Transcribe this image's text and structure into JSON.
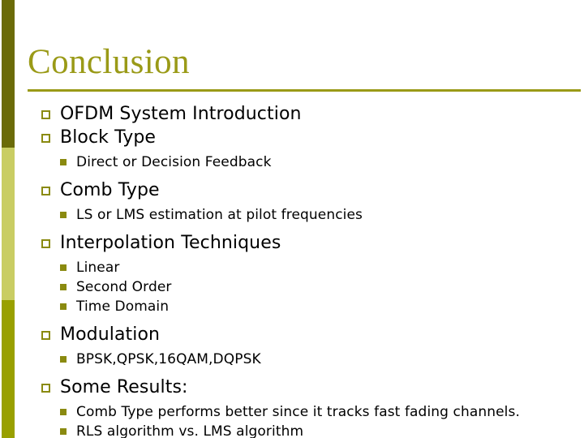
{
  "slide": {
    "title": "Conclusion",
    "colors": {
      "title_text": "#9a9a17",
      "title_rule": "#9a9a17",
      "sidebar_top": "#6b6b08",
      "sidebar_middle": "#c9cd63",
      "sidebar_bottom": "#99a000",
      "bullet_marker": "#8a8a10",
      "body_text": "#000000",
      "background": "#ffffff"
    },
    "bullets": [
      {
        "level": 1,
        "text": "OFDM System Introduction"
      },
      {
        "level": 1,
        "text": "Block Type"
      },
      {
        "level": 2,
        "text": "Direct or Decision Feedback"
      },
      {
        "level": 1,
        "text": "Comb Type"
      },
      {
        "level": 2,
        "text": "LS or LMS estimation at pilot frequencies"
      },
      {
        "level": 1,
        "text": "Interpolation Techniques"
      },
      {
        "level": 2,
        "text": "Linear"
      },
      {
        "level": 2,
        "text": "Second Order"
      },
      {
        "level": 2,
        "text": "Time Domain"
      },
      {
        "level": 1,
        "text": "Modulation"
      },
      {
        "level": 2,
        "text": "BPSK,QPSK,16QAM,DQPSK"
      },
      {
        "level": 1,
        "text": "Some Results:"
      },
      {
        "level": 2,
        "text": "Comb Type performs better since it tracks fast fading channels."
      },
      {
        "level": 2,
        "text": "RLS algorithm vs. LMS algorithm"
      }
    ]
  }
}
